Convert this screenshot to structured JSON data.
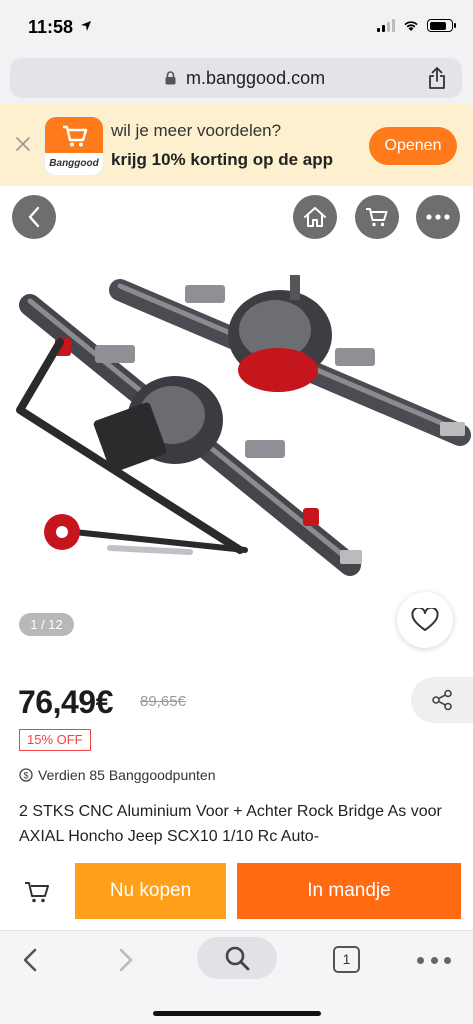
{
  "status": {
    "time": "11:58"
  },
  "browser": {
    "url": "m.banggood.com",
    "tab_count": "1"
  },
  "banner": {
    "logo_text": "Banggood",
    "line1": "wil je meer voordelen?",
    "line2": "krijg 10% korting op de app",
    "open_label": "Openen",
    "accent": "#ff7a1a",
    "background": "#fdf0cf"
  },
  "gallery": {
    "counter": "1 / 12"
  },
  "product": {
    "price": "76,49€",
    "old_price": "89,65€",
    "discount": "15% OFF",
    "points": "Verdien 85 Banggoodpunten",
    "title": "2 STKS CNC Aluminium Voor + Achter Rock Bridge As voor AXIAL Honcho Jeep SCX10 1/10 Rc Auto-"
  },
  "actions": {
    "buy_now": "Nu kopen",
    "add_to_cart": "In mandje",
    "buy_color": "#ff9f1a",
    "cart_color": "#ff6a13"
  },
  "icons": {
    "nav": [
      "back-icon",
      "home-icon",
      "cart-icon",
      "more-icon"
    ],
    "toolbar": [
      "back-icon",
      "forward-icon",
      "search-icon",
      "tabs-icon",
      "more-icon"
    ]
  }
}
